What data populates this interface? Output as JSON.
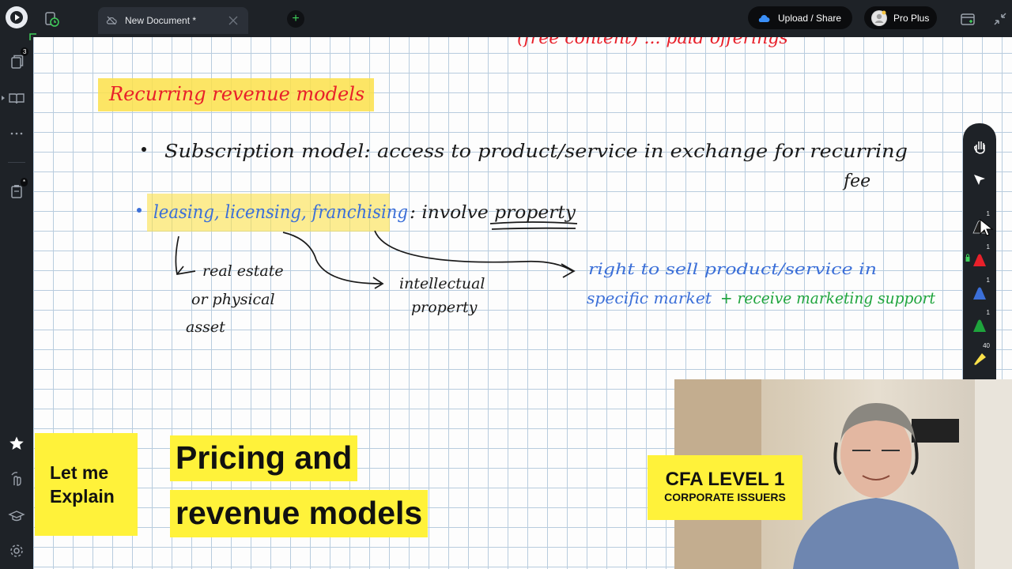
{
  "tabs": [
    {
      "label": "New Document *"
    }
  ],
  "toolbar": {
    "upload_label": "Upload / Share",
    "plan_label": "Pro Plus"
  },
  "sidebar": {
    "pages_badge": "3",
    "notes_badge": "*"
  },
  "palette": {
    "counts": [
      "1",
      "1",
      "1",
      "1",
      "40"
    ]
  },
  "notes": {
    "top_partial": "(free content) ... paid offerings",
    "heading": "Recurring revenue models",
    "bullet1": "Subscription model: access to product/service in exchange for recurring",
    "bullet1_cont": "fee",
    "bullet2_highlight": "leasing, licensing, franchising",
    "bullet2_rest": ": involve property",
    "branch1_line1": "real estate",
    "branch1_line2": "or physical",
    "branch1_line3": "asset",
    "branch2_line1": "intellectual",
    "branch2_line2": "property",
    "branch3_line1": "right to sell product/service in",
    "branch3_line2": "specific market",
    "branch3_line3": "+ receive marketing support"
  },
  "overlay": {
    "badge_line1": "Let me",
    "badge_line2": "Explain",
    "title_line1": "Pricing and",
    "title_line2": "revenue models",
    "cfa_line1": "CFA LEVEL 1",
    "cfa_line2": "CORPORATE ISSUERS"
  },
  "colors": {
    "ink_black": "#1a1a1a",
    "ink_red": "#e8202a",
    "ink_blue": "#3b6fd8",
    "ink_green": "#1ea43c",
    "highlight": "#fbe14a",
    "brand_yellow": "#fff23a"
  }
}
